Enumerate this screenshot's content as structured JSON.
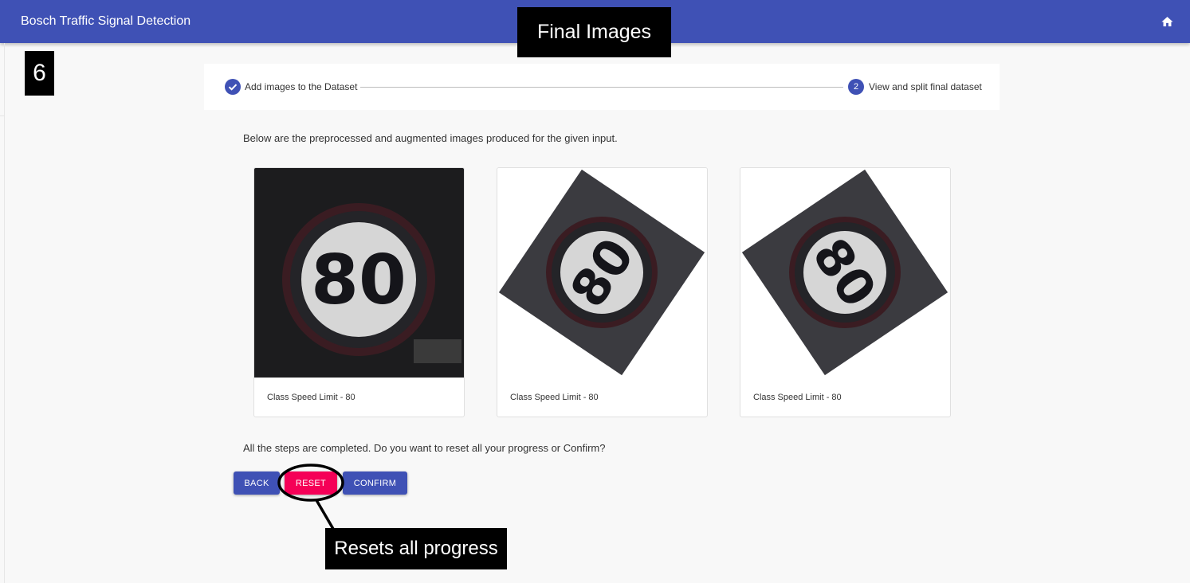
{
  "app": {
    "title": "Bosch Traffic Signal Detection",
    "home_icon": "home-icon"
  },
  "stepper": {
    "steps": [
      {
        "label": "Add images to the Dataset",
        "state": "completed",
        "icon": "check-icon"
      },
      {
        "label": "View and split final dataset",
        "number": "2",
        "state": "active"
      }
    ]
  },
  "main": {
    "intro": "Below are the preprocessed and augmented images produced for the given input.",
    "images": [
      {
        "caption": "Class Speed Limit - 80",
        "variant": "original",
        "sign_text": "80"
      },
      {
        "caption": "Class Speed Limit - 80",
        "variant": "rotated-left",
        "sign_text": "80"
      },
      {
        "caption": "Class Speed Limit - 80",
        "variant": "rotated-right",
        "sign_text": "80"
      }
    ],
    "question": "All the steps are completed. Do you want to reset all your progress or Confirm?",
    "buttons": {
      "back": "BACK",
      "reset": "RESET",
      "confirm": "CONFIRM"
    }
  },
  "annotations": {
    "step_number": "6",
    "title": "Final Images",
    "reset_note": "Resets all progress"
  },
  "colors": {
    "primary": "#3f51b5",
    "secondary": "#f50057",
    "annotation_bg": "#000000"
  }
}
